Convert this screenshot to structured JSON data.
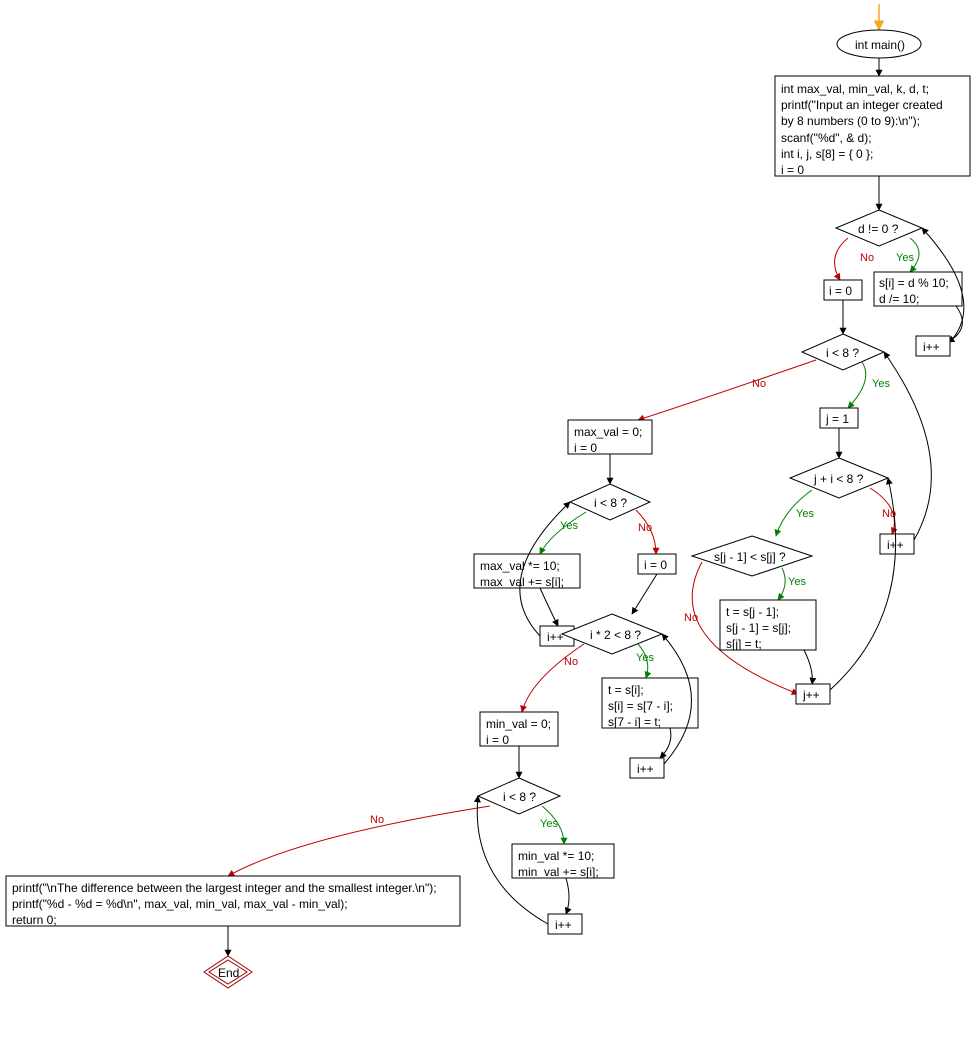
{
  "nodes": {
    "main": "int main()",
    "init": "int max_val, min_val, k, d, t;\nprintf(\"Input an integer created\nby 8 numbers (0 to 9):\\n\");\nscanf(\"%d\", & d);\nint i, j, s[8] = { 0 };\ni = 0",
    "cond_d": "d != 0 ?",
    "digit_extract": "s[i] = d % 10;\nd /= 10;",
    "ipp1": "i++",
    "i_eq_0": "i = 0",
    "cond_i_lt_8a": "i < 8 ?",
    "set_maxval": "max_val = 0;\ni = 0",
    "j_eq_1": "j = 1",
    "cond_j_i_lt_8": "j + i < 8 ?",
    "cond_sj": "s[j - 1] < s[j] ?",
    "ipp2": "i++",
    "swap_s": "t = s[j - 1];\ns[j - 1] = s[j];\ns[j] = t;",
    "jpp": "j++",
    "cond_i_lt_8b": "i < 8 ?",
    "maxval_ops": "max_val *= 10;\nmax_val += s[i];",
    "i_eq_0_2": "i = 0",
    "ipp3": "i++",
    "cond_i2_lt_8": "i * 2 < 8 ?",
    "swap_halves": "t = s[i];\ns[i] = s[7 - i];\ns[7 - i] = t;",
    "set_minval": "min_val = 0;\ni = 0",
    "ipp4": "i++",
    "cond_i_lt_8c": "i < 8 ?",
    "minval_ops": "min_val *= 10;\nmin_val += s[i];",
    "ipp5": "i++",
    "final": "printf(\"\\nThe difference between the largest integer and the smallest integer.\\n\");\nprintf(\"%d - %d = %d\\n\", max_val, min_val, max_val - min_val);\nreturn 0;",
    "end": "End"
  },
  "labels": {
    "yes": "Yes",
    "no": "No"
  }
}
